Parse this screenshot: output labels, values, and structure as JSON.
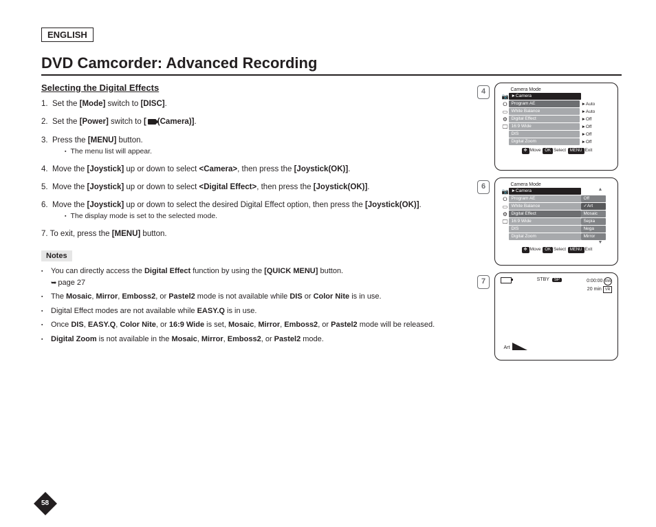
{
  "lang": "ENGLISH",
  "title": "DVD Camcorder: Advanced Recording",
  "subtitle": "Selecting the Digital Effects",
  "steps": {
    "s1": {
      "n": "1.",
      "pre": "Set the ",
      "b1": "[Mode]",
      "mid": " switch to ",
      "b2": "[DISC]",
      "post": "."
    },
    "s2": {
      "n": "2.",
      "pre": "Set the ",
      "b1": "[Power]",
      "mid": " switch to ",
      "b2a": "[",
      "b2b": "(Camera)]",
      "post": "."
    },
    "s3": {
      "n": "3.",
      "pre": "Press the ",
      "b1": "[MENU]",
      "post": " button.",
      "sub": "The menu list will appear."
    },
    "s4": {
      "n": "4.",
      "pre": "Move the ",
      "b1": "[Joystick]",
      "mid": " up or down to select ",
      "b2": "<Camera>",
      "mid2": ", then press the ",
      "b3": "[Joystick(OK)]",
      "post": "."
    },
    "s5": {
      "n": "5.",
      "pre": "Move the ",
      "b1": "[Joystick]",
      "mid": " up or down to select ",
      "b2": "<Digital Effect>",
      "mid2": ", then press the ",
      "b3": "[Joystick(OK)]",
      "post": "."
    },
    "s6": {
      "n": "6.",
      "pre": "Move the ",
      "b1": "[Joystick]",
      "mid": " up or down to select the desired Digital Effect option, then press the ",
      "b2": "[Joystick(OK)]",
      "post": ".",
      "sub": "The display mode is set to the selected mode."
    },
    "s7": {
      "full": "7. To exit, press the ",
      "b1": "[MENU]",
      "post": " button."
    }
  },
  "notes_hdr": "Notes",
  "notes": {
    "n1": {
      "pre": "You can directly access the ",
      "b1": "Digital Effect",
      "mid": " function by using the ",
      "b2": "[QUICK MENU]",
      "post": " button.",
      "ref": "page 27"
    },
    "n2": {
      "pre": "The ",
      "b1": "Mosaic",
      "c": ", ",
      "b2": "Mirror",
      "b3": "Emboss2",
      "or": ", or ",
      "b4": "Pastel2",
      "mid": " mode is not available while ",
      "b5": "DIS",
      "or2": " or ",
      "b6": "Color Nite",
      "post": " is in use."
    },
    "n3": {
      "pre": "Digital Effect modes are not available while ",
      "b1": "EASY.Q",
      "post": " is in use."
    },
    "n4": {
      "pre": "Once ",
      "b1": "DIS",
      "c": ", ",
      "b2": "EASY.Q",
      "b3": "Color Nite",
      "or": ", or ",
      "b4": "16:9 Wide",
      "mid": " is set, ",
      "b5": "Mosaic",
      "b6": "Mirror",
      "b7": "Emboss2",
      "or2": ", or ",
      "b8": "Pastel2",
      "post": " mode will be released."
    },
    "n5": {
      "b1": "Digital Zoom",
      "pre2": " is not available in the ",
      "b2": "Mosaic",
      "c": ", ",
      "b3": "Mirror",
      "b4": "Emboss2",
      "or": ", or ",
      "b5": "Pastel2",
      "post": " mode."
    }
  },
  "badges": {
    "b4": "4",
    "b6": "6",
    "b7": "7"
  },
  "screen4": {
    "title": "Camera Mode",
    "hdr": "►Camera",
    "rows": [
      {
        "l": "Program AE",
        "r": "►Auto"
      },
      {
        "l": "White Balance",
        "r": "►Auto"
      },
      {
        "l": "Digital Effect",
        "r": "►Off"
      },
      {
        "l": "16:9 Wide",
        "r": "►Off"
      },
      {
        "l": "DIS",
        "r": "►Off"
      },
      {
        "l": "Digital Zoom",
        "r": "►Off"
      }
    ],
    "foot": {
      "move": "Move",
      "ok": "OK",
      "select": "Select",
      "menu": "MENU",
      "exit": "Exit"
    }
  },
  "screen6": {
    "title": "Camera Mode",
    "hdr": "►Camera",
    "rows": [
      {
        "l": "Program AE",
        "r": "Off"
      },
      {
        "l": "White Balance",
        "r": "✓Art",
        "hl": true
      },
      {
        "l": "Digital Effect",
        "r": "Mosaic"
      },
      {
        "l": "16:9 Wide",
        "r": "Sepia"
      },
      {
        "l": "DIS",
        "r": "Nega"
      },
      {
        "l": "Digital Zoom",
        "r": "Mirror"
      }
    ],
    "foot": {
      "move": "Move",
      "ok": "OK",
      "select": "Select",
      "menu": "MENU",
      "exit": "Exit"
    }
  },
  "screen7": {
    "stby": "STBY",
    "sp": "SP",
    "time": "0:00:00",
    "min": "20 min",
    "rw": "RW",
    "vr": "VR",
    "art": "Art"
  },
  "pagenum": "58"
}
